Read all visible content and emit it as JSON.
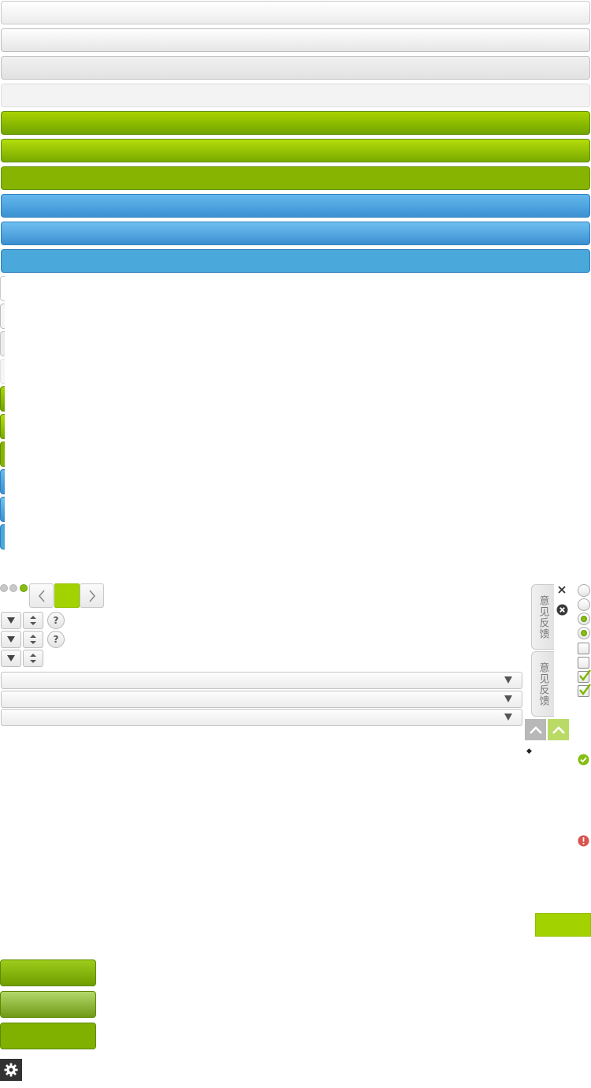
{
  "feedback_tab": {
    "label": "意见反馈"
  },
  "colors": {
    "accent_green": "#a2d200",
    "accent_blue": "#4aa8da",
    "error_red": "#d9534f",
    "settings_dark": "#333333"
  },
  "sprite_states": [
    "gray-normal",
    "gray-hover",
    "gray-active",
    "gray-flat",
    "green-normal",
    "green-hover",
    "green-active",
    "blue-normal",
    "blue-hover",
    "blue-active"
  ],
  "carousel": {
    "dot_count": 3,
    "active_index": 2
  },
  "icons": {
    "close": "close-icon",
    "close_circle": "close-circle-icon",
    "success": "check-circle-icon",
    "error": "exclamation-circle-icon",
    "settings": "gear-icon",
    "back_to_top": "chevron-up-icon",
    "prev": "chevron-left-icon",
    "next": "chevron-right-icon",
    "dropdown": "caret-down-icon",
    "stepper": "stepper-icon",
    "help": "help-icon"
  },
  "help": {
    "label": "?"
  },
  "misc": {
    "diamond_glyph": "◆"
  }
}
